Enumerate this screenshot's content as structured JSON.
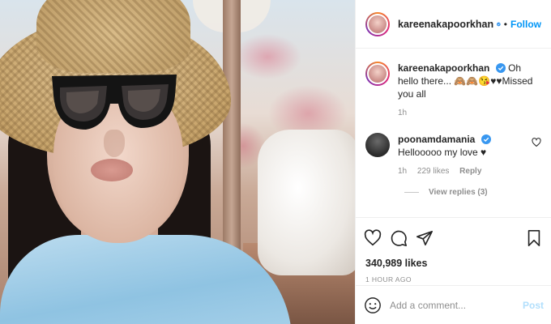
{
  "post": {
    "username": "kareenakapoorkhan",
    "follow_label": "Follow",
    "dot": "•"
  },
  "comments": [
    {
      "username": "kareenakapoorkhan",
      "text": "Oh hello there... 🙈🙈😘♥♥Missed you all",
      "time": "1h"
    },
    {
      "username": "poonamdamania",
      "text": "Hellooooo my love ♥",
      "time": "1h",
      "likes": "229 likes",
      "reply_label": "Reply",
      "view_replies": "View replies (3)"
    }
  ],
  "actions": {
    "likes_count": "340,989 likes",
    "time_ago": "1 HOUR AGO"
  },
  "add_comment": {
    "placeholder": "Add a comment...",
    "post_label": "Post"
  },
  "colors": {
    "verified": "#3897f0",
    "follow": "#0095f6",
    "post_disabled": "#b2dffc"
  },
  "icons": [
    "verified-badge-icon",
    "heart-icon",
    "comment-icon",
    "share-icon",
    "bookmark-icon",
    "emoji-icon"
  ]
}
